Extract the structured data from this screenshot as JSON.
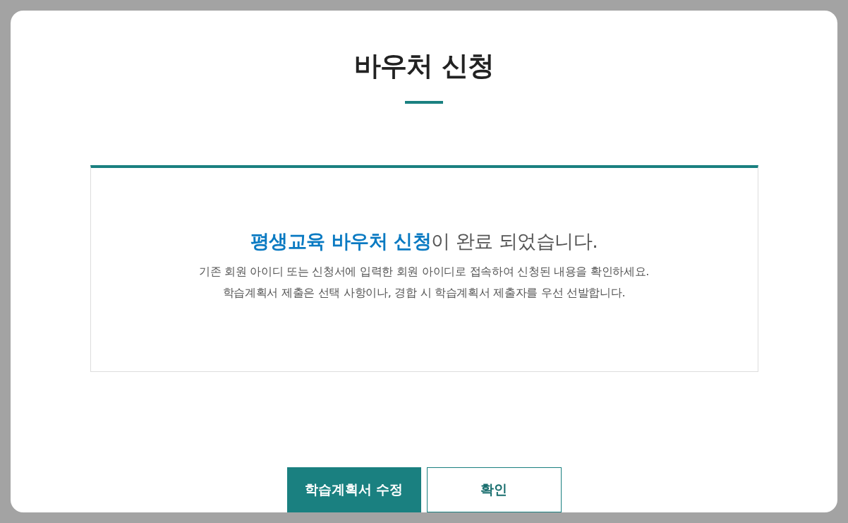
{
  "dialog": {
    "title": "바우처 신청",
    "message": {
      "headline": "**평생교육 바우처 신청**이 완료 되었습니다.",
      "lines": [
        "기존 회원 아이디 또는 신청서에 입력한 회원 아이디로 접속하여 신청된 내용을 확인하세요.",
        "학습계획서 제출은 선택 사항이나, 경합 시 학습계획서 제출자를 우선 선발합니다."
      ]
    },
    "buttons": [
      {
        "label": "학습계획서 수정",
        "kind": "primary"
      },
      {
        "label": "확인",
        "kind": "secondary"
      }
    ]
  }
}
